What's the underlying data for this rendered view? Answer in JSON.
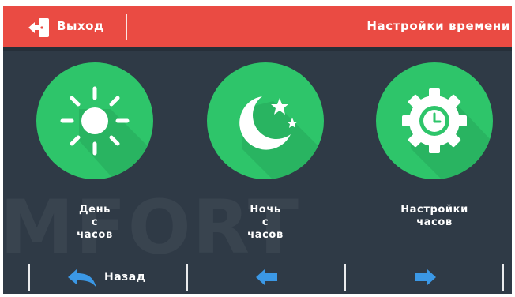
{
  "header": {
    "exit_label": "Выход",
    "title": "Настройки времени"
  },
  "watermark": "MFORT",
  "tiles": [
    {
      "label": "День\nс\nчасов",
      "icon": "sun-icon"
    },
    {
      "label": "Ночь\nс\nчасов",
      "icon": "moon-stars-icon"
    },
    {
      "label": "Настройки\nчасов",
      "icon": "gear-clock-icon"
    }
  ],
  "footer": {
    "back_label": "Назад"
  },
  "colors": {
    "header_red": "#ea4b43",
    "background": "#2f3a46",
    "tile_green": "#2ec56a",
    "arrow_blue": "#3b98e6"
  }
}
